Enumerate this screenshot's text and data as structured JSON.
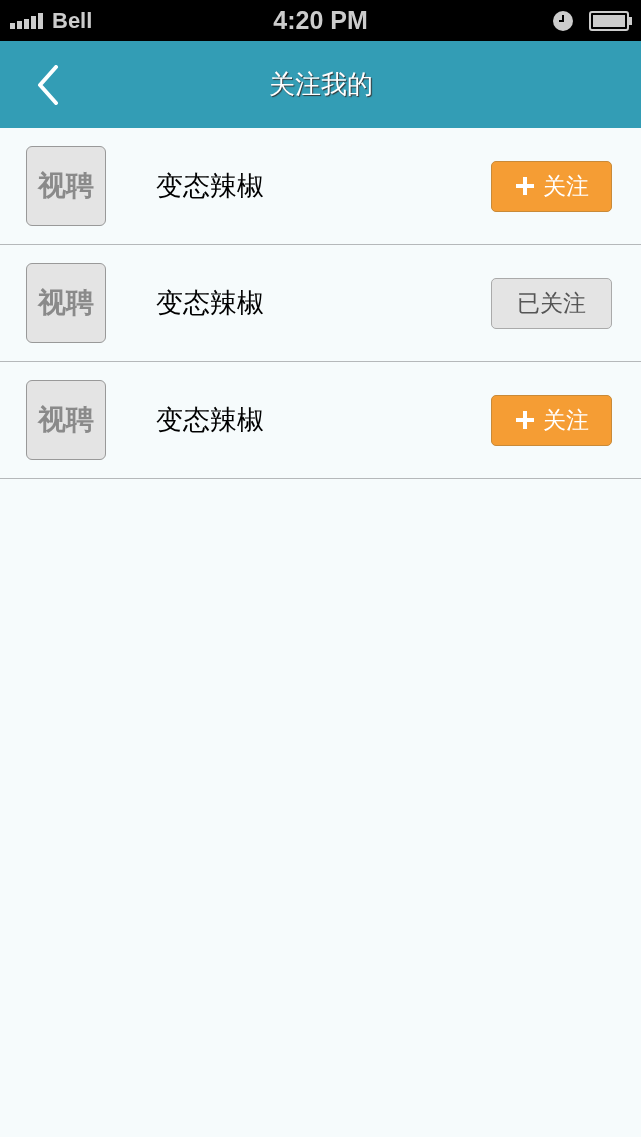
{
  "status_bar": {
    "carrier": "Bell",
    "time": "4:20 PM"
  },
  "nav_bar": {
    "title": "关注我的"
  },
  "users": [
    {
      "avatar_text": "视聘",
      "name": "变态辣椒",
      "followed": false,
      "button_label": "关注"
    },
    {
      "avatar_text": "视聘",
      "name": "变态辣椒",
      "followed": true,
      "button_label": "已关注"
    },
    {
      "avatar_text": "视聘",
      "name": "变态辣椒",
      "followed": false,
      "button_label": "关注"
    }
  ]
}
